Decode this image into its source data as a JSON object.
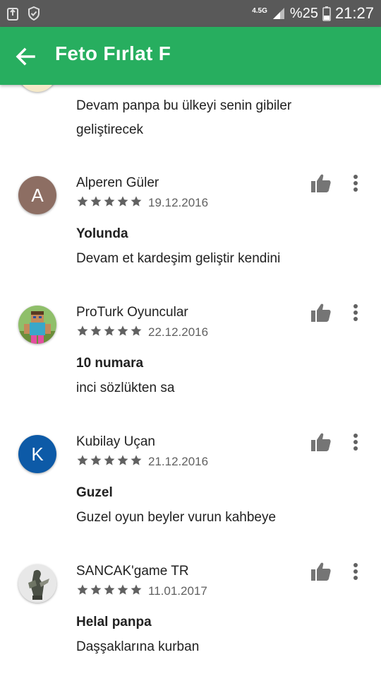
{
  "status_bar": {
    "network": "4.5G",
    "battery": "%25",
    "time": "21:27"
  },
  "app_bar": {
    "title": "Feto Fırlat F"
  },
  "partial_review": {
    "body": "Devam panpa bu ülkeyi senin gibiler geliştirecek"
  },
  "reviews": [
    {
      "name": "Alperen Güler",
      "avatar_letter": "A",
      "avatar_color": "#8d6e63",
      "rating": 5,
      "date": "19.12.2016",
      "title": "Yolunda",
      "body": "Devam et kardeşim geliştir kendini"
    },
    {
      "name": "ProTurk Oyuncular",
      "avatar_letter": "",
      "avatar_color": "#6b8e5a",
      "rating": 5,
      "date": "22.12.2016",
      "title": "10 numara",
      "body": "inci sözlükten sa"
    },
    {
      "name": "Kubilay Uçan",
      "avatar_letter": "K",
      "avatar_color": "#0d5aa7",
      "rating": 5,
      "date": "21.12.2016",
      "title": "Guzel",
      "body": "Guzel oyun beyler vurun kahbeye"
    },
    {
      "name": "SANCAK'game TR",
      "avatar_letter": "",
      "avatar_color": "#e0e0e0",
      "rating": 5,
      "date": "11.01.2017",
      "title": "Helal panpa",
      "body": "Daşşaklarına kurban"
    }
  ]
}
